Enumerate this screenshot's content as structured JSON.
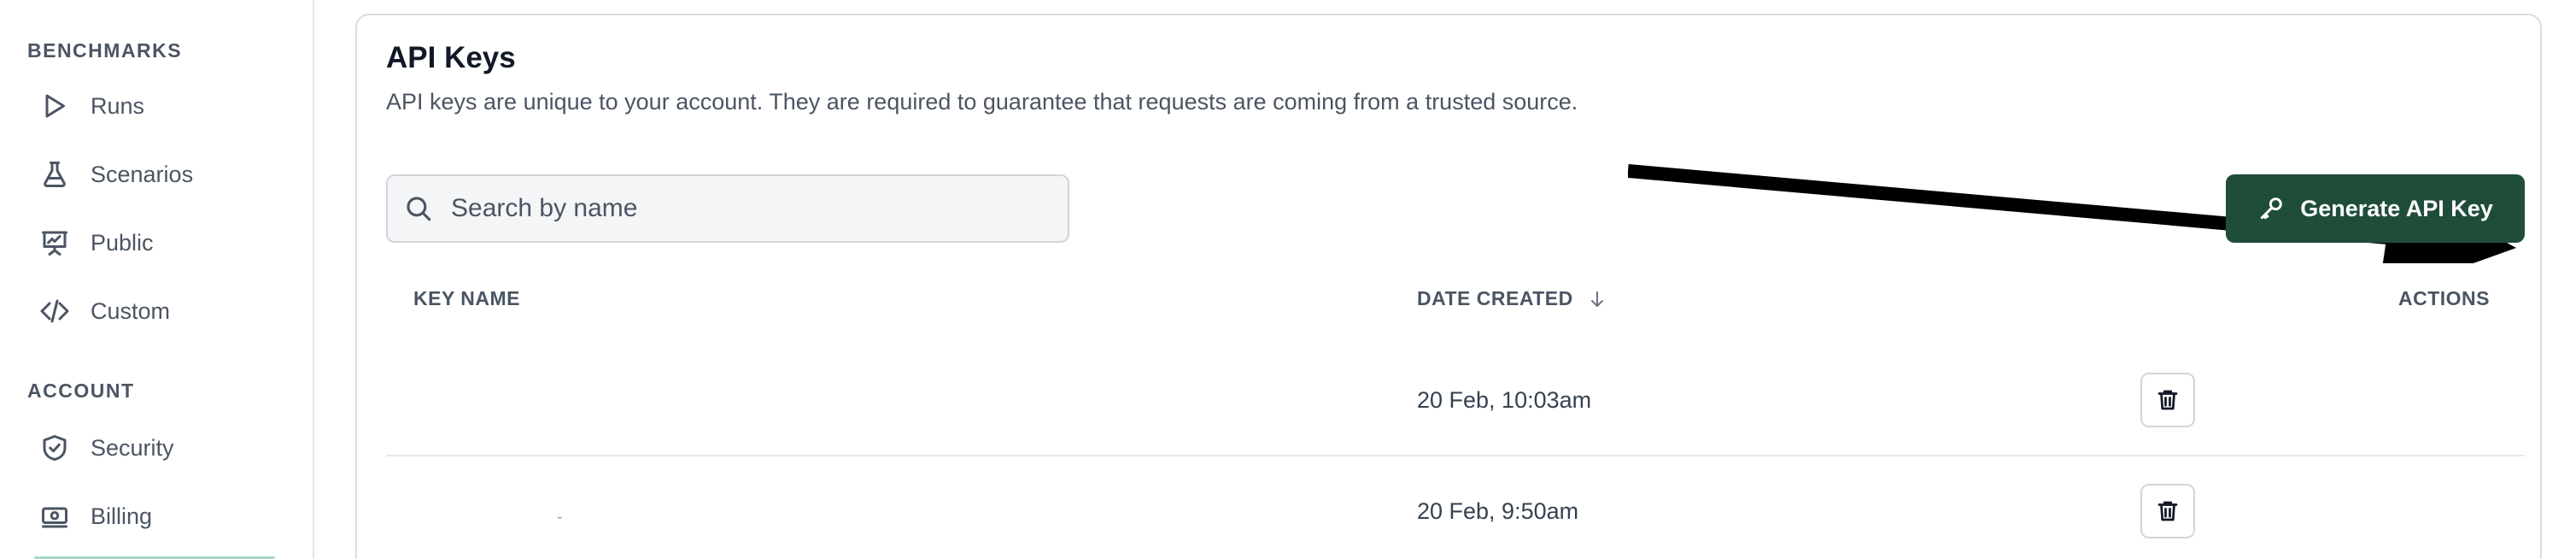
{
  "sidebar": {
    "benchmarks_heading": "BENCHMARKS",
    "benchmarks_items": [
      {
        "label": "Runs",
        "icon": "play-icon"
      },
      {
        "label": "Scenarios",
        "icon": "flask-icon"
      },
      {
        "label": "Public",
        "icon": "presentation-chart-icon"
      },
      {
        "label": "Custom",
        "icon": "code-icon"
      }
    ],
    "account_heading": "ACCOUNT",
    "account_items": [
      {
        "label": "Security",
        "icon": "shield-check-icon"
      },
      {
        "label": "Billing",
        "icon": "money-icon"
      }
    ]
  },
  "main": {
    "title": "API Keys",
    "description": "API keys are unique to your account. They are required to guarantee that requests are coming from a trusted source.",
    "search": {
      "placeholder": "Search by name",
      "value": "",
      "icon": "search-icon"
    },
    "generate_button": {
      "label": "Generate API Key",
      "icon": "key-icon"
    },
    "table": {
      "headers": {
        "key_name": "KEY NAME",
        "date_created": "DATE CREATED",
        "actions": "ACTIONS"
      },
      "sort_icon": "arrow-down-icon",
      "rows": [
        {
          "name": "",
          "date": "20 Feb, 10:03am"
        },
        {
          "name": "-",
          "date": "20 Feb, 9:50am"
        }
      ],
      "delete_icon": "trash-icon"
    }
  },
  "colors": {
    "primary_button": "#1f4d3a",
    "text_muted": "#4b5563",
    "border": "#d9dce1"
  }
}
